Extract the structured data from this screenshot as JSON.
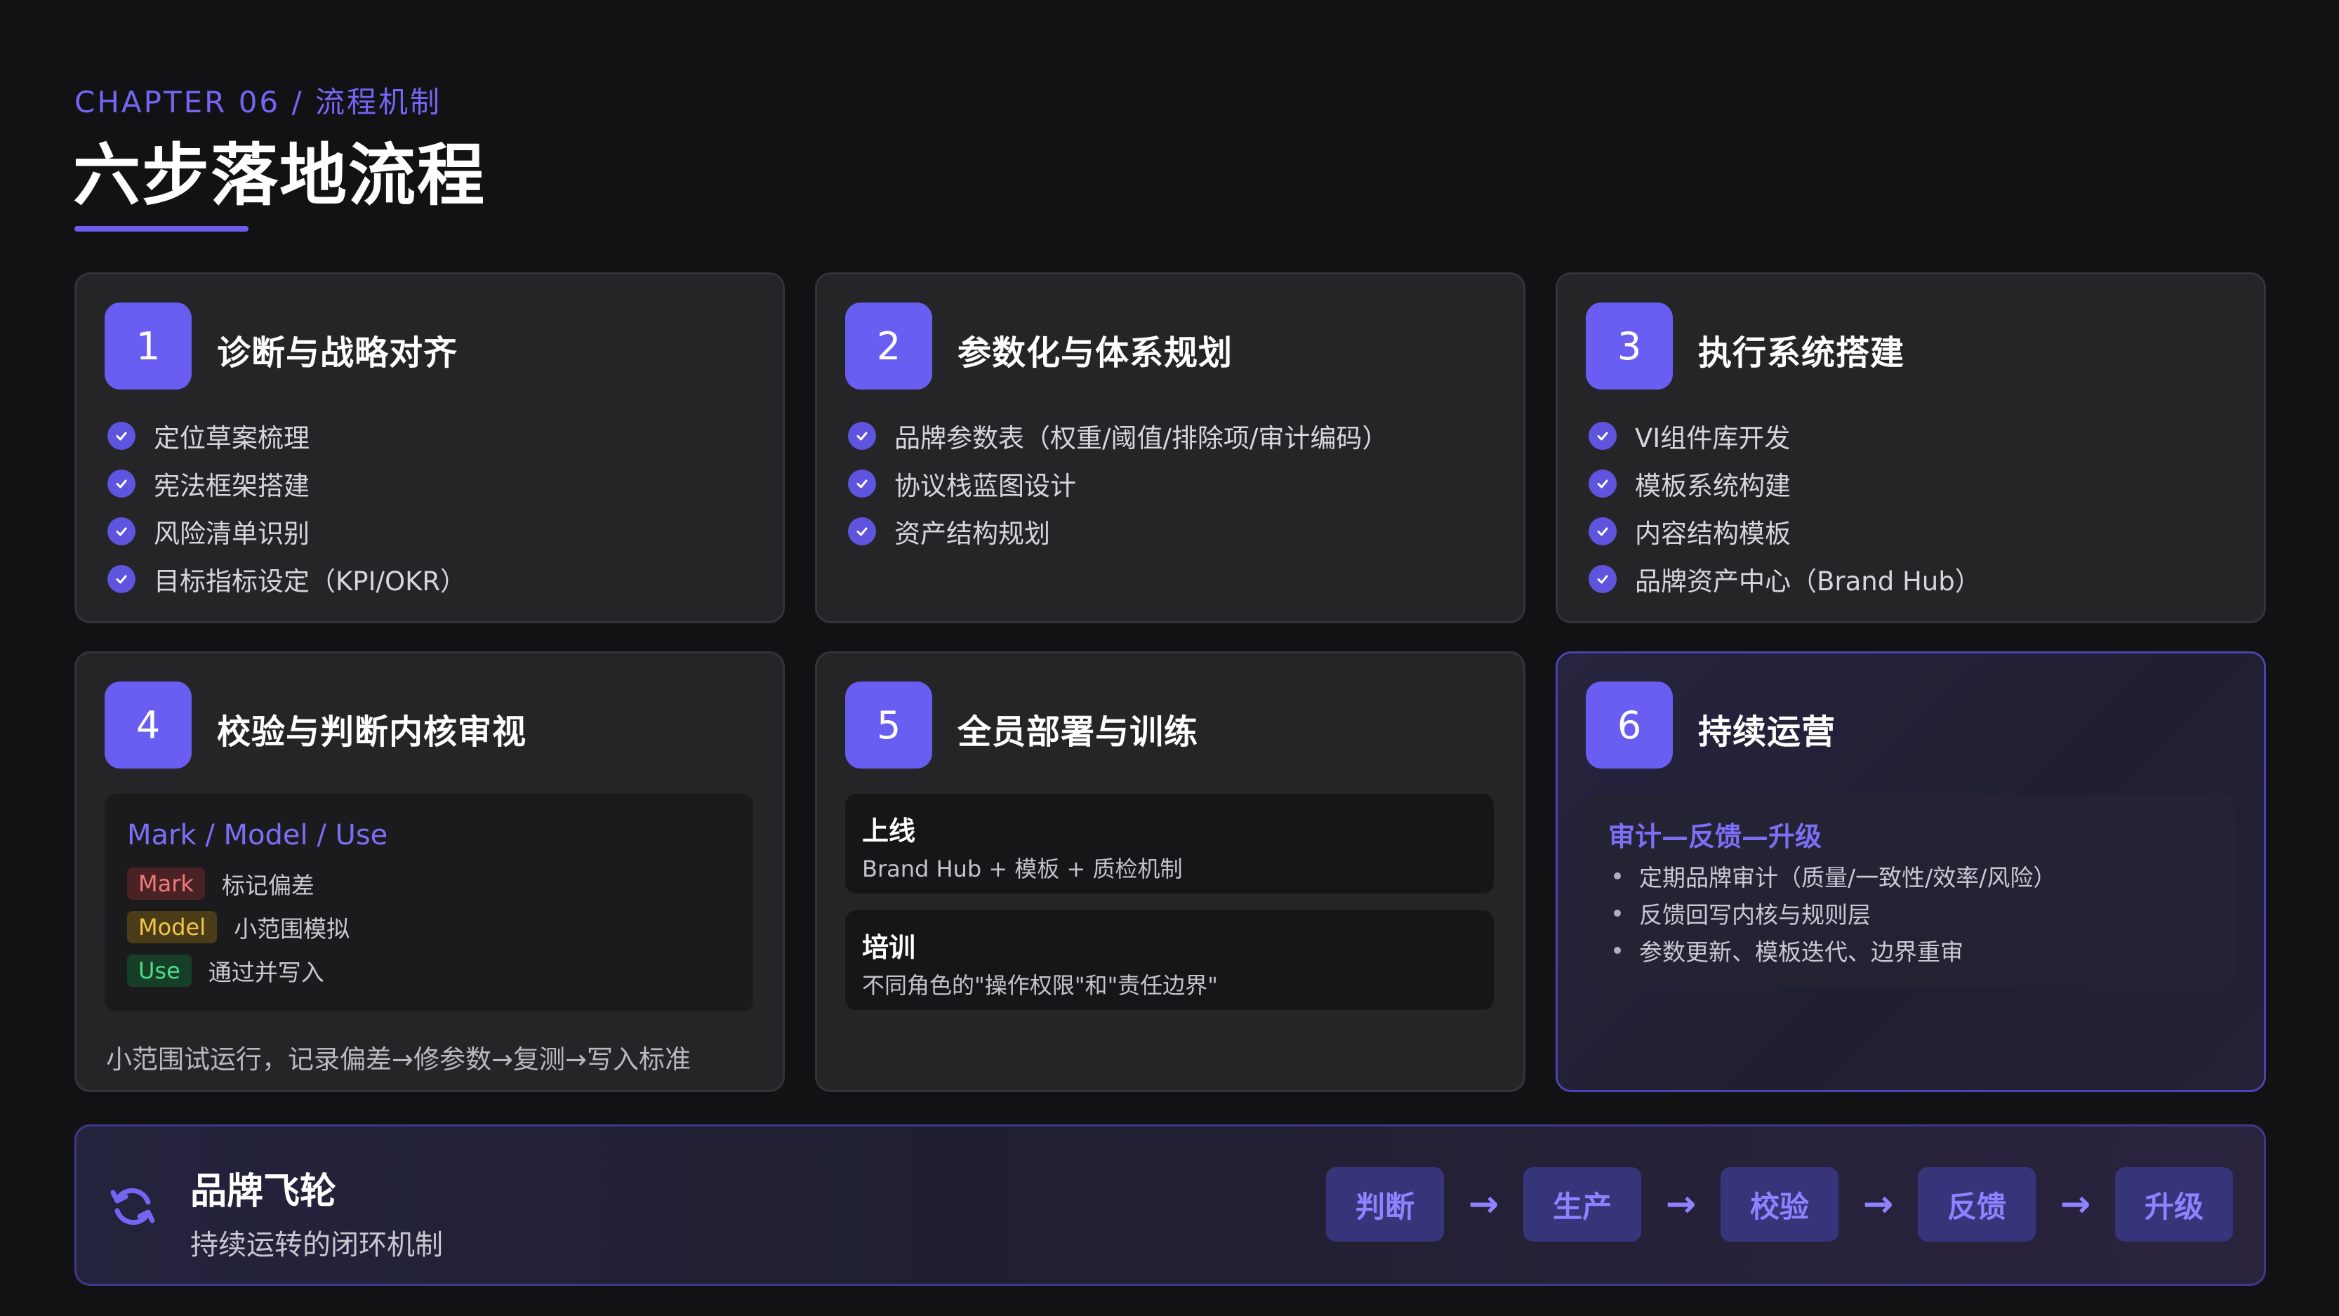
{
  "header": {
    "chapter": "CHAPTER 06 / 流程机制",
    "title": "六步落地流程"
  },
  "colors": {
    "accent": "#6A5DF2",
    "background": "#121114",
    "card": "#252528",
    "tag_red": "#F07A7A",
    "tag_yellow": "#F2C54A",
    "tag_green": "#4CDB86"
  },
  "steps": [
    {
      "number": "1",
      "title": "诊断与战略对齐",
      "items": [
        "定位草案梳理",
        "宪法框架搭建",
        "风险清单识别",
        "目标指标设定（KPI/OKR）"
      ]
    },
    {
      "number": "2",
      "title": "参数化与体系规划",
      "items": [
        "品牌参数表（权重/阈值/排除项/审计编码）",
        "协议栈蓝图设计",
        "资产结构规划"
      ]
    },
    {
      "number": "3",
      "title": "执行系统搭建",
      "items": [
        "VI组件库开发",
        "模板系统构建",
        "内容结构模板",
        "品牌资产中心（Brand Hub）"
      ]
    },
    {
      "number": "4",
      "title": "校验与判断内核审视",
      "box_title": "Mark / Model / Use",
      "tags": [
        {
          "tag": "Mark",
          "desc": "标记偏差"
        },
        {
          "tag": "Model",
          "desc": "小范围模拟"
        },
        {
          "tag": "Use",
          "desc": "通过并写入"
        }
      ],
      "footer": "小范围试运行，记录偏差→修参数→复测→写入标准"
    },
    {
      "number": "5",
      "title": "全员部署与训练",
      "blocks": [
        {
          "title": "上线",
          "desc": "Brand Hub + 模板 + 质检机制"
        },
        {
          "title": "培训",
          "desc": "不同角色的\"操作权限\"和\"责任边界\""
        }
      ]
    },
    {
      "number": "6",
      "title": "持续运营",
      "box_title": "审计—反馈—升级",
      "items": [
        "定期品牌审计（质量/一致性/效率/风险）",
        "反馈回写内核与规则层",
        "参数更新、模板迭代、边界重审"
      ]
    }
  ],
  "flywheel": {
    "title": "品牌飞轮",
    "subtitle": "持续运转的闭环机制",
    "icon": "refresh-icon",
    "stages": [
      "判断",
      "生产",
      "校验",
      "反馈",
      "升级"
    ],
    "arrow": "→"
  }
}
